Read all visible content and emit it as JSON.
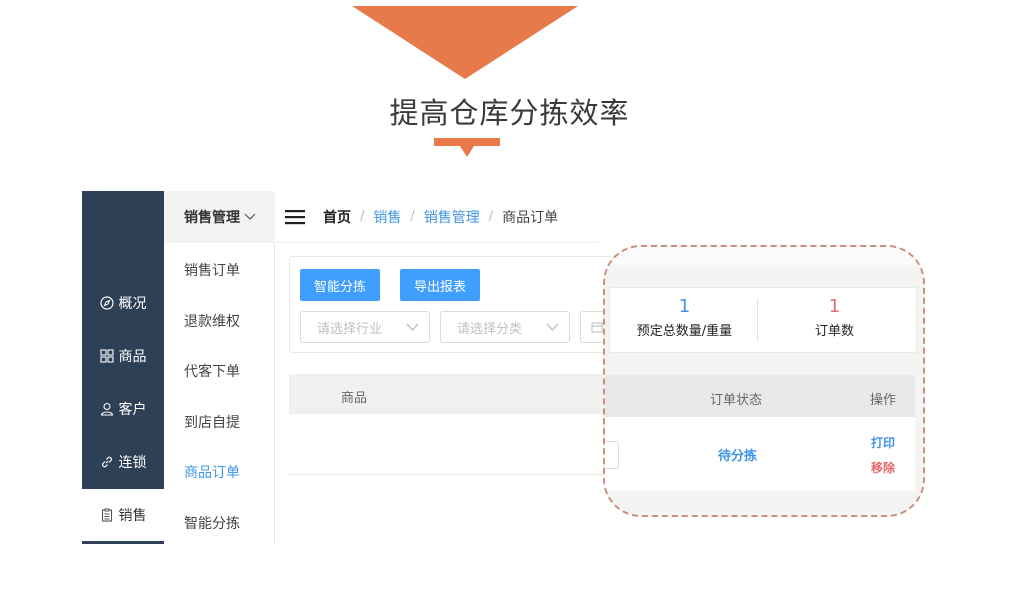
{
  "hero": {
    "title": "提高仓库分拣效率",
    "accent_color": "#e8794a"
  },
  "nav": {
    "items": [
      {
        "label": "概况",
        "icon": "compass-icon"
      },
      {
        "label": "商品",
        "icon": "grid-icon"
      },
      {
        "label": "客户",
        "icon": "user-icon"
      },
      {
        "label": "连锁",
        "icon": "link-icon"
      },
      {
        "label": "销售",
        "icon": "clipboard-icon"
      }
    ],
    "active": "销售",
    "bg_color": "#2e4055"
  },
  "submenu": {
    "heading": "销售管理",
    "items": [
      "销售订单",
      "退款维权",
      "代客下单",
      "到店自提",
      "商品订单",
      "智能分拣"
    ],
    "active": "商品订单"
  },
  "breadcrumb": {
    "home": "首页",
    "items": [
      "销售",
      "销售管理"
    ],
    "current": "商品订单",
    "separator": "/"
  },
  "toolbar": {
    "smart_sort_label": "智能分拣",
    "export_label": "导出报表",
    "industry_placeholder": "请选择行业",
    "category_placeholder": "请选择分类"
  },
  "table": {
    "columns": {
      "product": "商品",
      "order_status": "订单状态",
      "actions": "操作"
    }
  },
  "stats": {
    "total_qty": {
      "value": "1",
      "label": "预定总数量/重量",
      "color": "#3d96e8"
    },
    "order_count": {
      "value": "1",
      "label": "订单数",
      "color": "#e86a6a"
    }
  },
  "row": {
    "status": "待分拣",
    "print_label": "打印",
    "remove_label": "移除"
  }
}
